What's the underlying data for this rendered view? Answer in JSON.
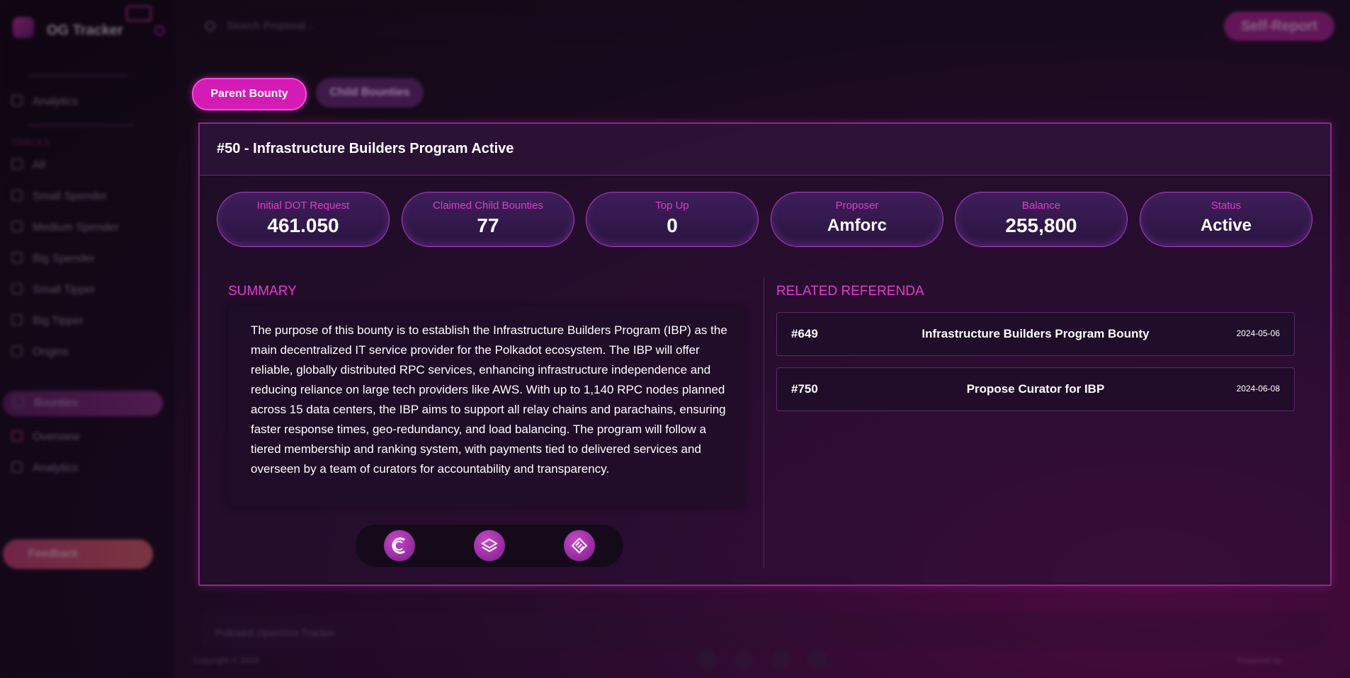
{
  "sidebar": {
    "app_title": "OG Tracker",
    "analytics": "Analytics",
    "section": "TRACKS",
    "items": [
      "All",
      "Small Spender",
      "Medium Spender",
      "Big Spender",
      "Small Tipper",
      "Big Tipper",
      "Origins"
    ],
    "bounties": "Bounties",
    "overview": "Overview",
    "analytics_sub": "Analytics",
    "feedback": "Feedback"
  },
  "header": {
    "search_placeholder": "Search Proposal...",
    "self_report": "Self-Report"
  },
  "tabs": {
    "parent": "Parent Bounty",
    "child": "Child Bounties"
  },
  "bounty": {
    "title": "#50 - Infrastructure Builders Program Active",
    "stats": [
      {
        "label": "Initial DOT Request",
        "value": "461.050"
      },
      {
        "label": "Claimed Child Bounties",
        "value": "77"
      },
      {
        "label": "Top Up",
        "value": "0"
      },
      {
        "label": "Proposer",
        "value": "Amforc"
      },
      {
        "label": "Balance",
        "value": "255,800"
      },
      {
        "label": "Status",
        "value": "Active"
      }
    ],
    "summary_title": "SUMMARY",
    "summary_text": "The purpose of this bounty is to establish the Infrastructure Builders Program (IBP) as the main decentralized IT service provider for the Polkadot ecosystem. The IBP will offer reliable, globally distributed RPC services, enhancing infrastructure independence and reducing reliance on large tech providers like AWS. With up to 1,140 RPC nodes planned across 15 data centers, the IBP aims to support all relay chains and parachains, ensuring faster response times, geo-redundancy, and load balancing. The program will follow a tiered membership and ranking system, with payments tied to delivered services and overseen by a team of curators for accountability and transparency.",
    "related_title": "RELATED REFERENDA",
    "referenda": [
      {
        "id": "#649",
        "title": "Infrastructure Builders Program Bounty",
        "date": "2024-05-06"
      },
      {
        "id": "#750",
        "title": "Propose Curator for IBP",
        "date": "2024-06-08"
      }
    ],
    "link_icons": [
      "subsquare-icon",
      "polkassembly-icon",
      "subscan-icon"
    ]
  },
  "footer": {
    "bar_text": "Polkadot OpenGov Tracker",
    "copyright": "Copyright © 2024",
    "powered": "Powered by"
  },
  "colors": {
    "accent": "#e63ad2",
    "tab_active": "#d41bb6",
    "panel_border": "#8a2a8c"
  }
}
